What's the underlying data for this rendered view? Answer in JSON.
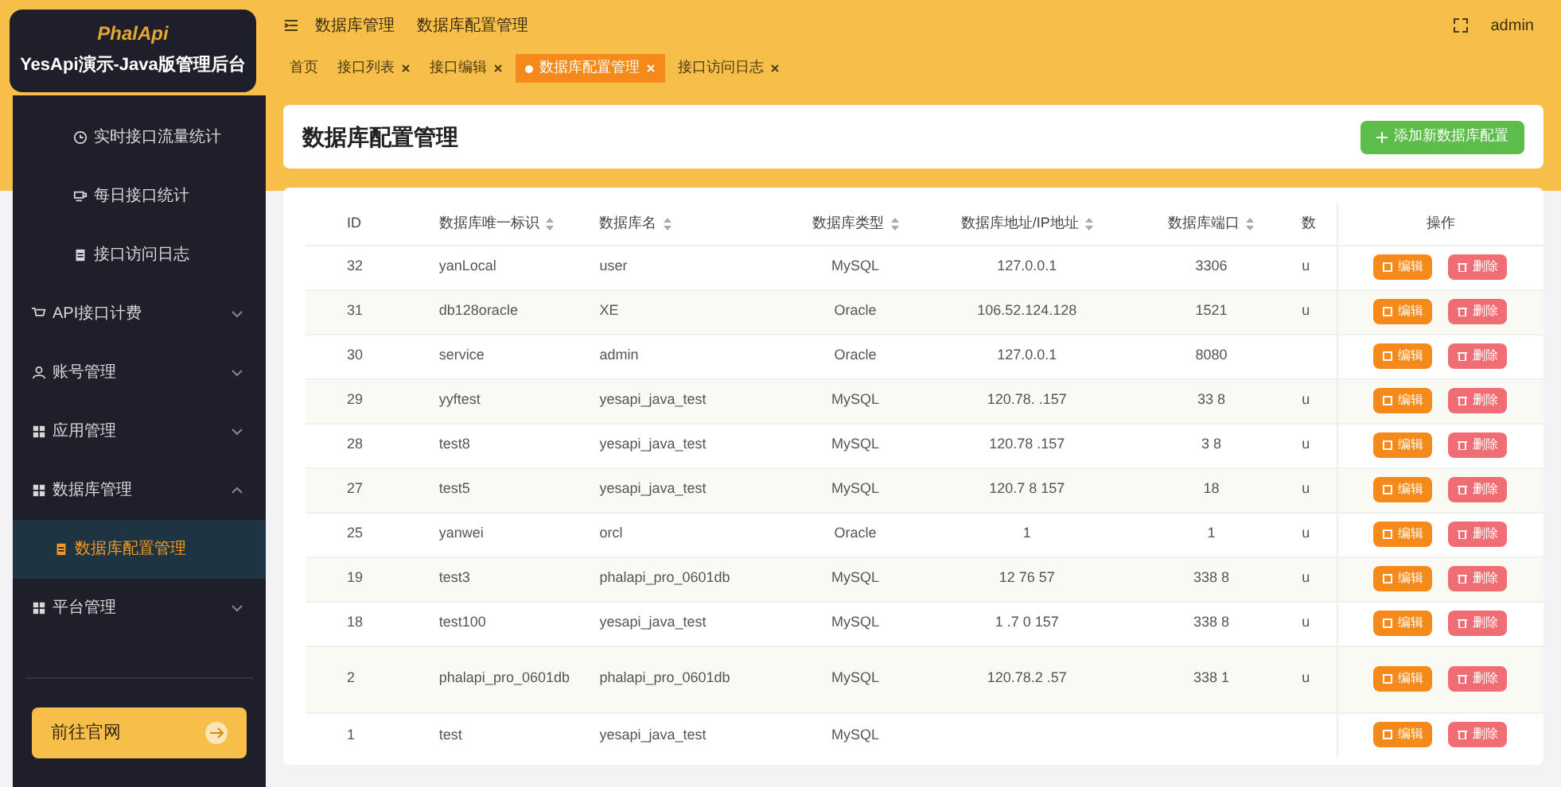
{
  "brand": {
    "logo": "PhalApi",
    "title": "YesApi演示-Java版管理后台"
  },
  "breadcrumb": [
    "数据库管理",
    "数据库配置管理"
  ],
  "user": "admin",
  "tabs": [
    {
      "label": "首页",
      "closable": false,
      "selected": false
    },
    {
      "label": "接口列表",
      "closable": true,
      "selected": false
    },
    {
      "label": "接口编辑",
      "closable": true,
      "selected": false
    },
    {
      "label": "数据库配置管理",
      "closable": true,
      "selected": true
    },
    {
      "label": "接口访问日志",
      "closable": true,
      "selected": false
    }
  ],
  "sidebar": {
    "items": [
      {
        "label": "实时接口流量统计",
        "kind": "sub",
        "selected": false
      },
      {
        "label": "每日接口统计",
        "kind": "sub",
        "selected": false
      },
      {
        "label": "接口访问日志",
        "kind": "sub",
        "selected": false
      },
      {
        "label": "API接口计费",
        "kind": "group",
        "expanded": false,
        "selected": false
      },
      {
        "label": "账号管理",
        "kind": "group",
        "expanded": false,
        "selected": false
      },
      {
        "label": "应用管理",
        "kind": "group",
        "expanded": false,
        "selected": false
      },
      {
        "label": "数据库管理",
        "kind": "group",
        "expanded": true,
        "selected": false
      },
      {
        "label": "数据库配置管理",
        "kind": "sub",
        "selected": true
      },
      {
        "label": "平台管理",
        "kind": "group",
        "expanded": false,
        "selected": false
      }
    ],
    "footer_button": "前往官网"
  },
  "page_title": "数据库配置管理",
  "add_button": "添加新数据库配置",
  "table": {
    "columns": [
      {
        "label": "ID",
        "sortable": false
      },
      {
        "label": "数据库唯一标识",
        "sortable": true
      },
      {
        "label": "数据库名",
        "sortable": true
      },
      {
        "label": "数据库类型",
        "sortable": true
      },
      {
        "label": "数据库地址/IP地址",
        "sortable": true
      },
      {
        "label": "数据库端口",
        "sortable": true
      },
      {
        "label": "数",
        "sortable": false
      },
      {
        "label": "操作",
        "sortable": false
      }
    ],
    "rows": [
      {
        "cells": [
          "32",
          "yanLocal",
          "user",
          "MySQL",
          "127.0.0.1",
          "3306",
          "u"
        ],
        "actions": [
          "编辑",
          "删除"
        ]
      },
      {
        "cells": [
          "31",
          "db128oracle",
          "XE",
          "Oracle",
          "106.52.124.128",
          "1521",
          "u"
        ],
        "actions": [
          "编辑",
          "删除"
        ]
      },
      {
        "cells": [
          "30",
          "service",
          "admin",
          "Oracle",
          "127.0.0.1",
          "8080",
          ""
        ],
        "actions": [
          "编辑",
          "删除"
        ]
      },
      {
        "cells": [
          "29",
          "yyftest",
          "yesapi_java_test",
          "MySQL",
          "120.78.  .157",
          "33  8",
          "u"
        ],
        "actions": [
          "编辑",
          "删除"
        ]
      },
      {
        "cells": [
          "28",
          "test8",
          "yesapi_java_test",
          "MySQL",
          "120.78  .157",
          "3   8",
          "u"
        ],
        "actions": [
          "编辑",
          "删除"
        ]
      },
      {
        "cells": [
          "27",
          "test5",
          "yesapi_java_test",
          "MySQL",
          "120.7  8 157",
          "  18",
          "u"
        ],
        "actions": [
          "编辑",
          "删除"
        ]
      },
      {
        "cells": [
          "25",
          "yanwei",
          "orcl",
          "Oracle",
          "1",
          "1",
          "u"
        ],
        "actions": [
          "编辑",
          "删除"
        ]
      },
      {
        "cells": [
          "19",
          "test3",
          "phalapi_pro_0601db",
          "MySQL",
          "12  76    57",
          "338 8",
          "u"
        ],
        "actions": [
          "编辑",
          "删除"
        ]
      },
      {
        "cells": [
          "18",
          "test100",
          "yesapi_java_test",
          "MySQL",
          "1 .7  0 157",
          "338 8",
          "u"
        ],
        "actions": [
          "编辑",
          "删除"
        ]
      },
      {
        "cells": [
          "2",
          "phalapi_pro_0601db",
          "phalapi_pro_0601db",
          "MySQL",
          "120.78.2  .57",
          "338 1",
          "u"
        ],
        "actions": [
          "编辑",
          "删除"
        ]
      },
      {
        "cells": [
          "1",
          "test",
          "yesapi_java_test",
          "MySQL",
          "",
          "",
          ""
        ],
        "actions": [
          "编辑",
          "删除"
        ]
      }
    ]
  }
}
